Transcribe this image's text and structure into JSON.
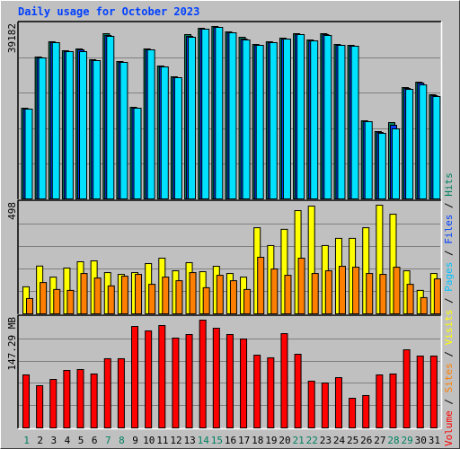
{
  "title": "Daily usage for October 2023",
  "legend": {
    "items": [
      {
        "name": "Volume",
        "color": "#ff0000"
      },
      {
        "name": "Sites",
        "color": "#ff8000"
      },
      {
        "name": "Visits",
        "color": "#ffff00"
      },
      {
        "name": "Pages",
        "color": "#00c0ff"
      },
      {
        "name": "Files",
        "color": "#0040ff"
      },
      {
        "name": "Hits",
        "color": "#008060"
      }
    ],
    "separator": " / "
  },
  "colors": {
    "hits": "#00805c",
    "files": "#0040ff",
    "pages": "#00e0ff",
    "visits": "#ffff00",
    "sites": "#ff8000",
    "volume": "#ff0000",
    "weekday_label": "#000000",
    "weekend_label": "#008060",
    "plot_bg": "#c0c0c0",
    "grid": "#808080"
  },
  "chart_data": [
    {
      "type": "bar",
      "title": "Daily usage for October 2023",
      "ylabel": "39182",
      "ylim": [
        0,
        39182
      ],
      "grid": true,
      "categories": [
        "1",
        "2",
        "3",
        "4",
        "5",
        "6",
        "7",
        "8",
        "9",
        "10",
        "11",
        "12",
        "13",
        "14",
        "15",
        "16",
        "17",
        "18",
        "19",
        "20",
        "21",
        "22",
        "23",
        "24",
        "25",
        "26",
        "27",
        "28",
        "29",
        "30",
        "31"
      ],
      "series": [
        {
          "name": "Hits",
          "values": [
            20191,
            31585,
            34984,
            32985,
            33384,
            30986,
            36783,
            30586,
            20391,
            33384,
            29586,
            27187,
            36583,
            37983,
            38383,
            37183,
            35984,
            34384,
            34984,
            35784,
            36783,
            35384,
            36783,
            34384,
            34184,
            17392,
            14993,
            16992,
            24788,
            25988,
            23189
          ]
        },
        {
          "name": "Files",
          "values": [
            19991,
            31385,
            34784,
            32785,
            33184,
            30786,
            36383,
            30386,
            20191,
            33184,
            29386,
            26987,
            36183,
            37783,
            38183,
            36983,
            35584,
            34184,
            34784,
            35584,
            36583,
            35184,
            36583,
            34184,
            33984,
            17192,
            14793,
            16392,
            24588,
            25788,
            22989
          ]
        },
        {
          "name": "Pages",
          "values": [
            19991,
            31385,
            34784,
            32785,
            32785,
            30786,
            36183,
            30386,
            20191,
            33184,
            29386,
            26987,
            35984,
            37783,
            38183,
            36983,
            35384,
            34184,
            34784,
            35584,
            36583,
            35184,
            36383,
            34184,
            33984,
            17192,
            14593,
            15593,
            24388,
            25388,
            22789
          ]
        }
      ]
    },
    {
      "type": "bar",
      "ylabel": "498",
      "ylim": [
        0,
        498
      ],
      "grid": true,
      "categories": [
        "1",
        "2",
        "3",
        "4",
        "5",
        "6",
        "7",
        "8",
        "9",
        "10",
        "11",
        "12",
        "13",
        "14",
        "15",
        "16",
        "17",
        "18",
        "19",
        "20",
        "21",
        "22",
        "23",
        "24",
        "25",
        "26",
        "27",
        "28",
        "29",
        "30",
        "31"
      ],
      "series": [
        {
          "name": "Visits",
          "values": [
            120,
            212,
            163,
            203,
            231,
            235,
            183,
            175,
            183,
            223,
            247,
            191,
            227,
            187,
            211,
            179,
            163,
            382,
            303,
            375,
            458,
            478,
            303,
            335,
            335,
            382,
            482,
            442,
            191,
            104,
            179
          ]
        },
        {
          "name": "Sites",
          "values": [
            68,
            139,
            108,
            104,
            179,
            159,
            124,
            167,
            175,
            131,
            163,
            147,
            183,
            116,
            171,
            147,
            108,
            251,
            199,
            171,
            247,
            179,
            191,
            211,
            207,
            179,
            175,
            207,
            131,
            72,
            155
          ]
        }
      ]
    },
    {
      "type": "bar",
      "ylabel": "147.29 MB",
      "ylim": [
        0,
        147.29
      ],
      "grid": true,
      "categories": [
        "1",
        "2",
        "3",
        "4",
        "5",
        "6",
        "7",
        "8",
        "9",
        "10",
        "11",
        "12",
        "13",
        "14",
        "15",
        "16",
        "17",
        "18",
        "19",
        "20",
        "21",
        "22",
        "23",
        "24",
        "25",
        "26",
        "27",
        "28",
        "29",
        "30",
        "31"
      ],
      "series": [
        {
          "name": "Volume",
          "values": [
            70.1,
            55.8,
            64.1,
            76.0,
            77.2,
            71.3,
            91.5,
            91.5,
            134.2,
            128.3,
            135.4,
            118.8,
            123.5,
            142.5,
            131.8,
            123.5,
            117.6,
            96.2,
            92.7,
            124.7,
            97.4,
            61.8,
            59.4,
            66.5,
            39.2,
            42.8,
            70.1,
            71.3,
            103.3,
            95.0,
            95.0
          ]
        }
      ]
    }
  ],
  "weekend_days": [
    1,
    7,
    8,
    14,
    15,
    21,
    22,
    28,
    29
  ]
}
